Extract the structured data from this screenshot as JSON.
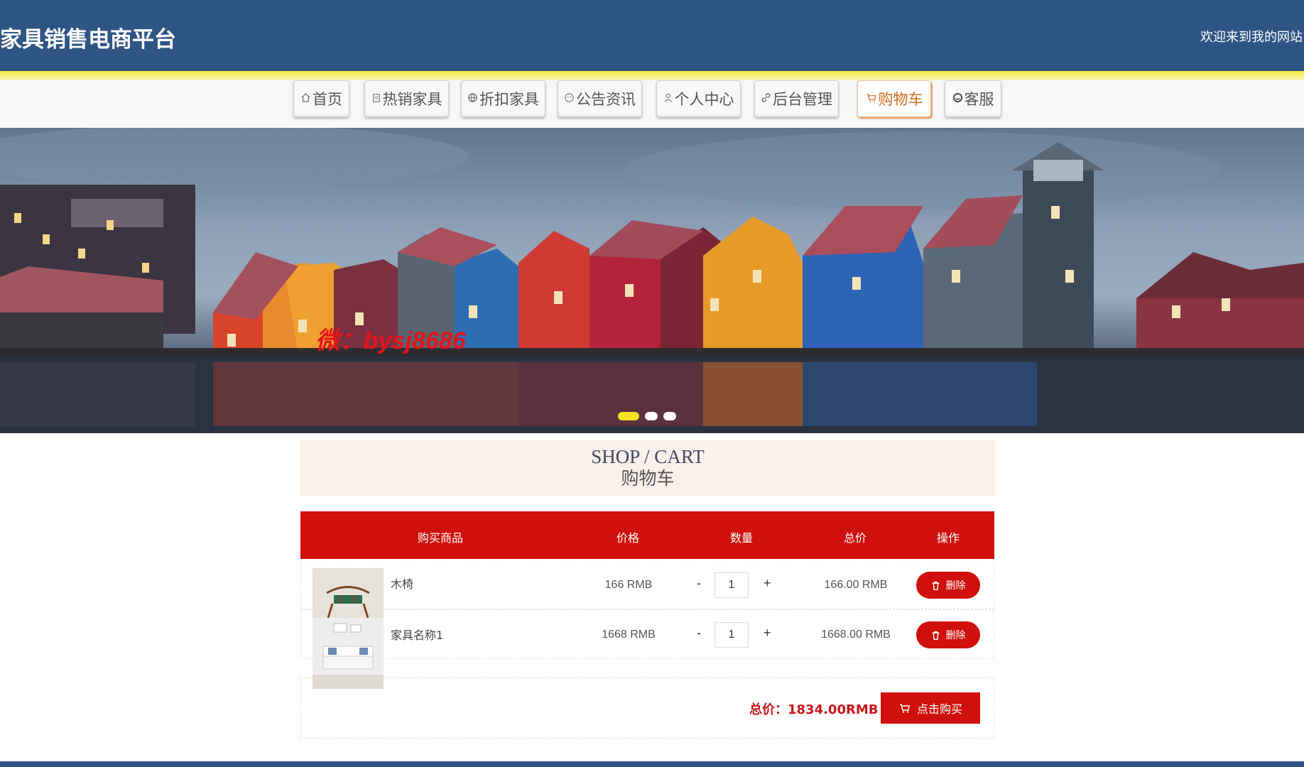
{
  "header": {
    "site_title": "家具销售电商平台",
    "welcome": "欢迎来到我的网站"
  },
  "nav": {
    "items": [
      {
        "label": "首页",
        "icon": "home-icon"
      },
      {
        "label": "热销家具",
        "icon": "document-icon"
      },
      {
        "label": "折扣家具",
        "icon": "globe-icon"
      },
      {
        "label": "公告资讯",
        "icon": "face-icon"
      },
      {
        "label": "个人中心",
        "icon": "user-icon"
      },
      {
        "label": "后台管理",
        "icon": "link-icon"
      },
      {
        "label": "购物车",
        "icon": "cart-icon",
        "active": true
      },
      {
        "label": "客服",
        "icon": "chat-icon"
      }
    ]
  },
  "banner": {
    "watermark": "微：bysj8686",
    "slides_count": 3,
    "active_slide": 1
  },
  "cart": {
    "title_en": "SHOP / CART",
    "title_cn": "购物车",
    "columns": [
      "购买商品",
      "价格",
      "数量",
      "总价",
      "操作"
    ],
    "rows": [
      {
        "name": "木椅",
        "price": "166 RMB",
        "qty": "1",
        "total": "166.00 RMB",
        "action": "删除",
        "minus": "-",
        "plus": "+"
      },
      {
        "name": "家具名称1",
        "price": "1668 RMB",
        "qty": "1",
        "total": "1668.00 RMB",
        "action": "删除",
        "minus": "-",
        "plus": "+"
      }
    ],
    "total_label": "总价：1834.00RMB",
    "buy_label": "点击购买"
  },
  "colors": {
    "header_bg": "#2f5585",
    "accent_red": "#d0100c",
    "accent_yellow": "#f5e640",
    "active_nav": "#d2691e"
  }
}
